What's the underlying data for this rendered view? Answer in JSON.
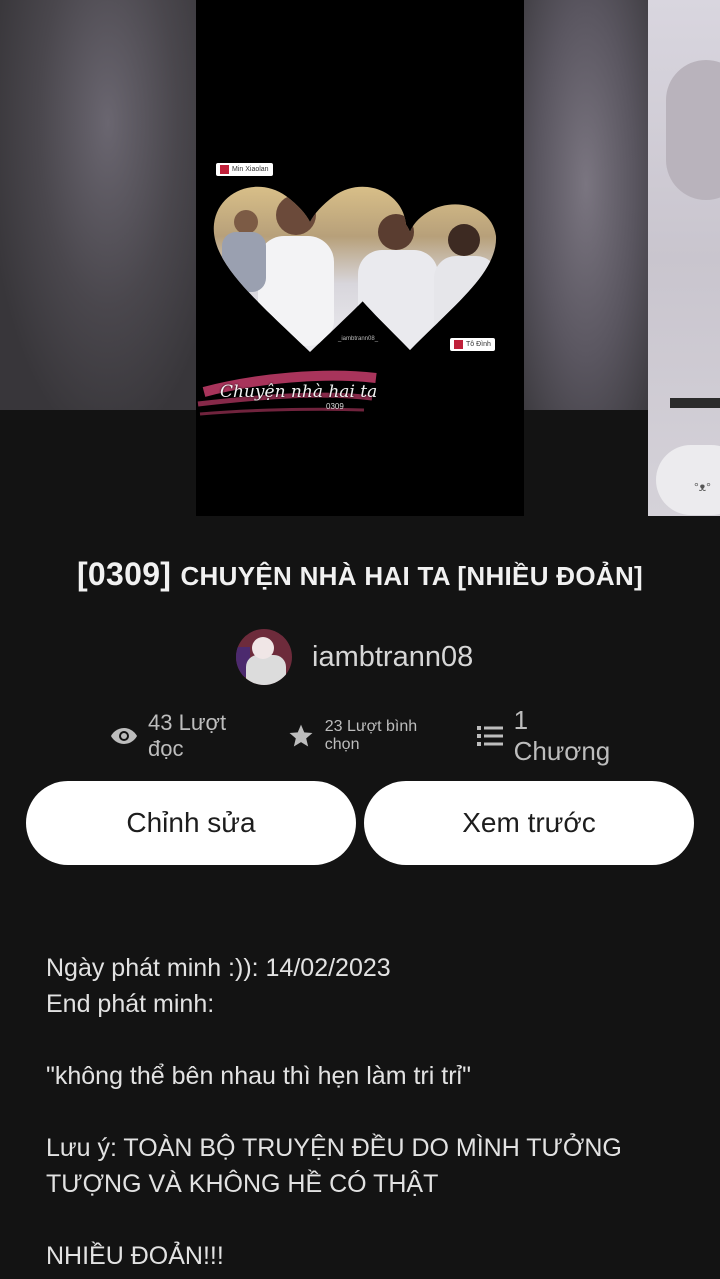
{
  "cover": {
    "title": "Chuyện nhà hai ta",
    "subtitle": "0309",
    "watermark": "_iambtrann08_",
    "tag_top": "Min Xiaolan",
    "tag_bottom": "Tô Đình"
  },
  "story": {
    "title_prefix": "[0309] ",
    "title_main": "CHUYỆN NHÀ HAI TA [NHIỀU ĐOẢN]"
  },
  "author": {
    "name": "iambtrann08"
  },
  "stats": {
    "reads": "43 Lượt đọc",
    "votes": "23 Lượt bình chọn",
    "parts": "1 Chương",
    "icons": [
      "eye-icon",
      "star-icon",
      "list-icon"
    ]
  },
  "buttons": {
    "edit": "Chỉnh sửa",
    "preview": "Xem trước"
  },
  "description": {
    "line1": "Ngày phát minh :)): 14/02/2023",
    "line2": "End phát minh:",
    "line3": "\"không thể bên nhau thì hẹn làm tri trỉ\"",
    "line4": "Lưu ý: TOÀN BỘ TRUYỆN ĐỀU DO MÌNH TƯỞNG TƯỢNG VÀ KHÔNG HỀ CÓ THẬT",
    "line5": "NHIỀU ĐOẢN!!!"
  },
  "colors": {
    "background": "#131313",
    "button_bg": "#ffffff",
    "text": "#e8e8e8",
    "muted": "#bdbdbd"
  }
}
